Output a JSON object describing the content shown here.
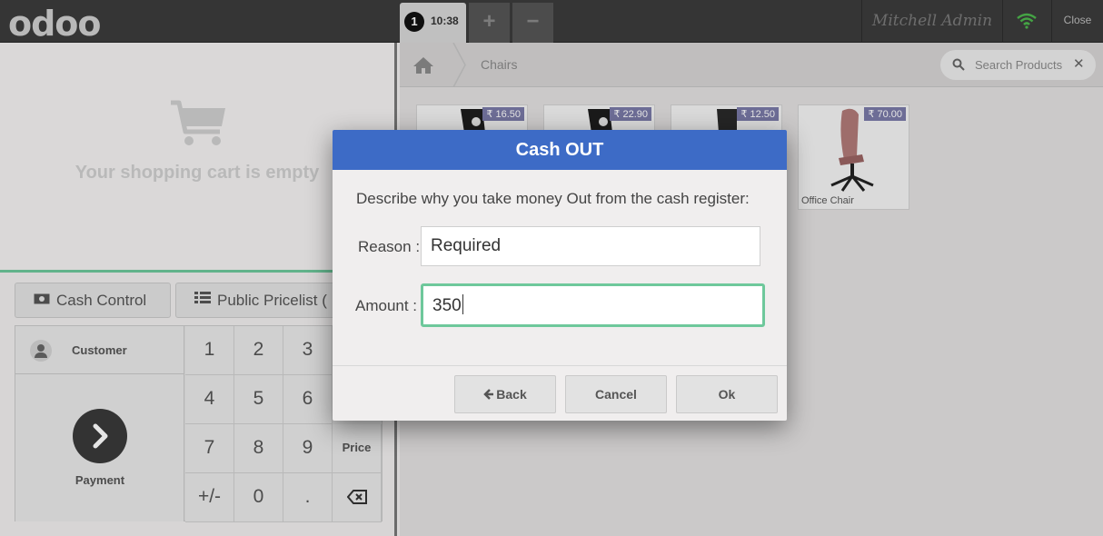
{
  "header": {
    "logo": "odoo",
    "order_number": "1",
    "order_time": "10:38",
    "add_order": "+",
    "remove_order": "−",
    "user": "Mitchell Admin",
    "close": "Close"
  },
  "cart": {
    "empty_text": "Your shopping cart is empty"
  },
  "controls": {
    "cash_control": "Cash Control",
    "pricelist": "Public Pricelist ("
  },
  "actionpad": {
    "customer": "Customer",
    "payment": "Payment"
  },
  "numpad": {
    "keys": [
      "1",
      "2",
      "3",
      "4",
      "5",
      "6",
      "7",
      "8",
      "9",
      "+/-",
      "0",
      "."
    ],
    "mode_price": "Price"
  },
  "breadcrumb": {
    "category": "Chairs"
  },
  "search": {
    "placeholder": "Search Products"
  },
  "products": [
    {
      "price": "₹ 16.50",
      "name": ""
    },
    {
      "price": "₹ 22.90",
      "name": ""
    },
    {
      "price": "₹ 12.50",
      "name": ""
    },
    {
      "price": "₹ 70.00",
      "name": "Office Chair"
    }
  ],
  "dialog": {
    "title": "Cash OUT",
    "description": "Describe why you take money Out from the cash register:",
    "reason_label": "Reason :",
    "reason_value": "Required",
    "amount_label": "Amount :",
    "amount_value": "350",
    "back": "Back",
    "cancel": "Cancel",
    "ok": "Ok"
  },
  "colors": {
    "header_bg": "#3c3c3c",
    "dialog_title_bg": "#3d6bc6",
    "accent_green": "#6ec89b",
    "wifi_green": "#4cb64c",
    "price_tag": "#7a7aa8"
  }
}
